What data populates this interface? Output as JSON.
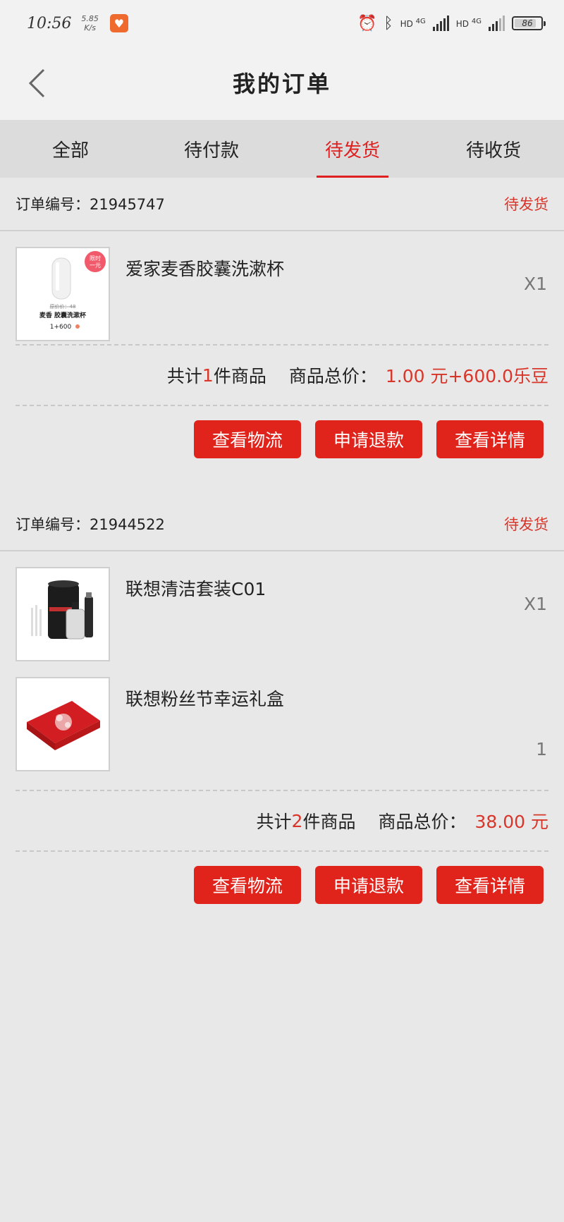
{
  "status_bar": {
    "time": "10:56",
    "speed_value": "5.85",
    "speed_unit": "K/s",
    "net1": "HD",
    "net1_gen": "4G",
    "net2": "HD",
    "net2_gen": "4G",
    "battery": "86",
    "battery_level": 0.86
  },
  "header": {
    "title": "我的订单",
    "back_icon": "chevron-left-icon"
  },
  "tabs": [
    {
      "label": "全部",
      "active": false
    },
    {
      "label": "待付款",
      "active": false
    },
    {
      "label": "待发货",
      "active": true
    },
    {
      "label": "待收货",
      "active": false
    }
  ],
  "orders": [
    {
      "number_label": "订单编号：",
      "number": "21945747",
      "status": "待发货",
      "products": [
        {
          "name": "爱家麦香胶囊洗漱杯",
          "qty": "X1",
          "thumb_text": {
            "badge_line1": "限时",
            "badge_line2": "一元",
            "price_strike": "原价价：48",
            "caption": "麦香 胶囊洗漱杯",
            "price": "1+600"
          }
        }
      ],
      "summary": {
        "prefix": "共计",
        "count": "1",
        "suffix": "件商品",
        "total_label": "商品总价：",
        "total": "1.00 元+600.0乐豆"
      },
      "buttons": [
        "查看物流",
        "申请退款",
        "查看详情"
      ]
    },
    {
      "number_label": "订单编号：",
      "number": "21944522",
      "status": "待发货",
      "products": [
        {
          "name": "联想清洁套装C01",
          "qty": "X1"
        },
        {
          "name": "联想粉丝节幸运礼盒",
          "qty": "1"
        }
      ],
      "summary": {
        "prefix": "共计",
        "count": "2",
        "suffix": "件商品",
        "total_label": "商品总价：",
        "total": "38.00 元"
      },
      "buttons": [
        "查看物流",
        "申请退款",
        "查看详情"
      ]
    }
  ],
  "colors": {
    "accent": "#e0241c",
    "status_red": "#d8362a",
    "background": "#e8e8e8"
  }
}
